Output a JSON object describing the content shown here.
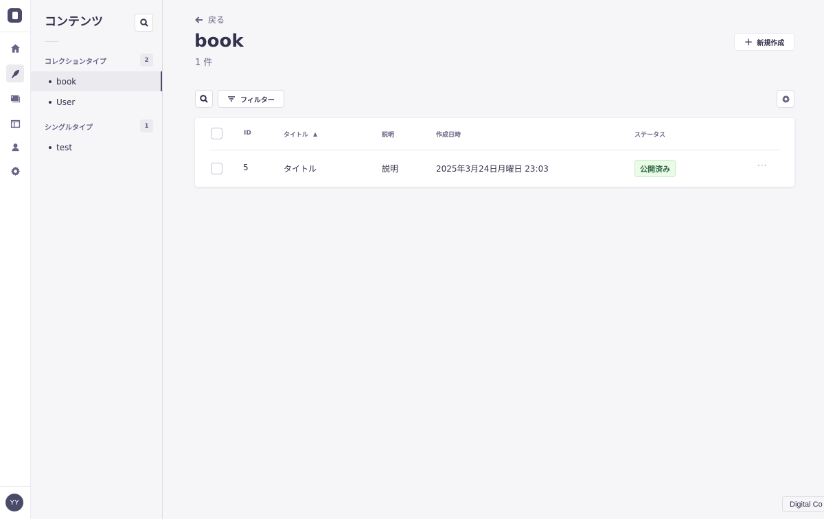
{
  "rail": {
    "items": [
      {
        "icon": "home-icon"
      },
      {
        "icon": "feather-icon",
        "active": true
      },
      {
        "icon": "media-library-icon"
      },
      {
        "icon": "layout-icon"
      },
      {
        "icon": "user-icon"
      },
      {
        "icon": "gear-icon"
      }
    ],
    "avatar_initials": "YY"
  },
  "sidebar": {
    "title": "コンテンツ",
    "collection_section": {
      "label": "コレクションタイプ",
      "count": "2"
    },
    "collection_items": [
      {
        "label": "book",
        "active": true
      },
      {
        "label": "User",
        "active": false
      }
    ],
    "single_section": {
      "label": "シングルタイプ",
      "count": "1"
    },
    "single_items": [
      {
        "label": "test"
      }
    ]
  },
  "header": {
    "back_label": "戻る",
    "title": "book",
    "count_label": "1 件",
    "new_button_label": "新規作成"
  },
  "toolbar": {
    "filter_label": "フィルター"
  },
  "table": {
    "columns": [
      "ID",
      "タイトル",
      "説明",
      "作成日時",
      "ステータス"
    ],
    "rows": [
      {
        "id": "5",
        "title": "タイトル",
        "description": "説明",
        "created_at": "2025年3月24日月曜日 23:03",
        "status": "公開済み",
        "more": "···"
      }
    ]
  },
  "toast_text": "Digital Co",
  "colors": {
    "accent": "#4a4a6a",
    "status_published_bg": "#eafbe7",
    "status_published_text": "#2f6846",
    "page_bg": "#f6f6f9"
  }
}
